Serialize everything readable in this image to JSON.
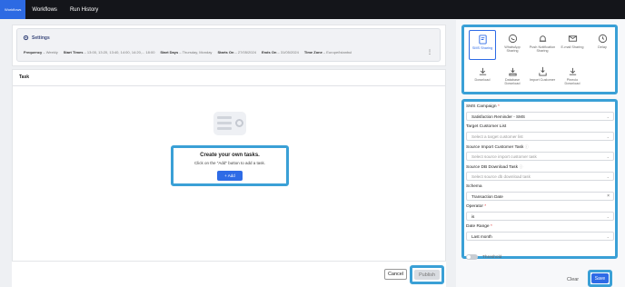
{
  "topbar": {
    "tabs": [
      {
        "label": "Workflows"
      },
      {
        "label": "Workflows"
      },
      {
        "label": "Run History"
      }
    ]
  },
  "settings": {
    "title": "Settings",
    "items": [
      {
        "label": "Frequency",
        "value": "Weekly"
      },
      {
        "label": "Start Times",
        "value": "13:00, 13:20, 13:40, 14:00, 14:20,... 18:00"
      },
      {
        "label": "Start Days",
        "value": "Thursday, Monday"
      },
      {
        "label": "Starts On",
        "value": "27/05/2024"
      },
      {
        "label": "Ends On",
        "value": "31/05/2024"
      },
      {
        "label": "Time Zone",
        "value": "Europe/Istanbul"
      }
    ]
  },
  "task": {
    "title": "Task",
    "empty_title": "Create your own tasks.",
    "empty_subtitle": "Click on the \"Add\" button to add a task.",
    "add_label": "+ Add"
  },
  "footer": {
    "cancel_label": "Cancel",
    "publish_label": "Publish"
  },
  "actions": [
    {
      "label": "SMS Sharing",
      "icon": "sms-share-icon",
      "active": true
    },
    {
      "label": "WhatsApp Sharing",
      "icon": "whatsapp-icon",
      "active": false
    },
    {
      "label": "Push Notification Sharing",
      "icon": "push-notification-icon",
      "active": false
    },
    {
      "label": "E-mail Sharing",
      "icon": "email-share-icon",
      "active": false
    },
    {
      "label": "Delay",
      "icon": "clock-icon",
      "active": false
    },
    {
      "label": "Download",
      "icon": "download-icon",
      "active": false
    },
    {
      "label": "Database Download",
      "icon": "database-download-icon",
      "active": false
    },
    {
      "label": "Import Customer",
      "icon": "import-icon",
      "active": false
    },
    {
      "label": "Pinecio Download",
      "icon": "download-icon",
      "active": false
    }
  ],
  "form": {
    "fields": [
      {
        "label": "SMS Campaign",
        "required": true,
        "info": false,
        "value": "Satisfaction Reminder - SMS",
        "placeholder": false,
        "control": "chevron"
      },
      {
        "label": "Target Customer List",
        "required": false,
        "info": false,
        "value": "Select a target customer list",
        "placeholder": true,
        "control": "chevron"
      },
      {
        "label": "Source Import Customer Task",
        "required": false,
        "info": true,
        "value": "Select source import customer task",
        "placeholder": true,
        "control": "chevron"
      },
      {
        "label": "Source DB Download Task",
        "required": false,
        "info": true,
        "value": "Select source db download task",
        "placeholder": true,
        "control": "chevron"
      },
      {
        "label": "Schema",
        "required": false,
        "info": false,
        "value": "Transaction Date",
        "placeholder": false,
        "control": "clear"
      },
      {
        "label": "Operator",
        "required": true,
        "info": false,
        "value": "is",
        "placeholder": false,
        "control": "chevron"
      },
      {
        "label": "Date Range",
        "required": true,
        "info": false,
        "value": "Last month",
        "placeholder": false,
        "control": "chevron"
      }
    ],
    "threshold_label": "Threshold",
    "clear_label": "Clear",
    "save_label": "Save"
  },
  "colors": {
    "accent": "#2e6be6",
    "highlight": "#3aa0d6",
    "topbar": "#14151a"
  }
}
